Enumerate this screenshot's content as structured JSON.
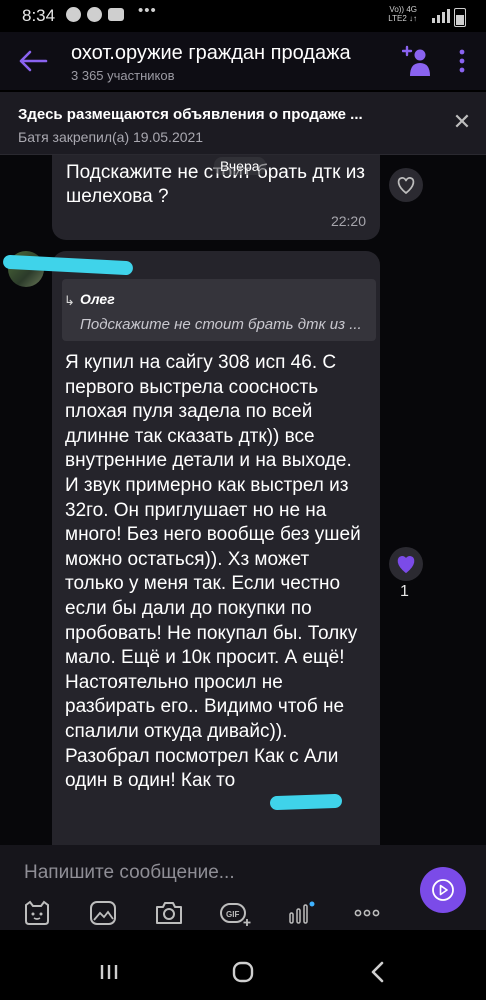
{
  "status_bar": {
    "time": "8:34",
    "network_line1": "Vo))  4G",
    "network_line2": "LTE2 ↓↑",
    "dots": "•••"
  },
  "header": {
    "title": "охот.оружие граждан продажа",
    "subtitle": "3 365 участников"
  },
  "pinned": {
    "title": "Здесь размещаются объявления о продаже ...",
    "subtitle": "Батя закрепил(а) 19.05.2021"
  },
  "chat": {
    "date_pill": "Вчера",
    "message1": {
      "text": "Подскажите не стоит брать дтк из шелехова ?",
      "time": "22:20"
    },
    "message2": {
      "quote_author": "Олег",
      "quote_text": "Подскажите не стоит брать дтк из ...",
      "text": "Я купил на сайгу 308 исп 46. С первого выстрела соосность плохая пуля задела по всей длинне так сказать дтк)) все внутренние детали и на выходе. И звук примерно как выстрел из 32го. Он приглушает но не на много! Без него вообще без ушей можно остаться)). Хз может только у меня так. Если честно если бы дали до покупки по пробовать! Не покупал бы. Толку мало. Ещё и 10к просит. А ещё! Настоятельно просил не разбирать его.. Видимо чтоб не спалили откуда дивайс)). Разобрал посмотрел Как с Али один в один! Как то",
      "like_count": "1"
    }
  },
  "composer": {
    "placeholder": "Напишите сообщение..."
  },
  "colors": {
    "accent": "#7b4be8",
    "bubble": "#25242b",
    "background": "#07070a",
    "redaction": "#3fd3ea"
  }
}
